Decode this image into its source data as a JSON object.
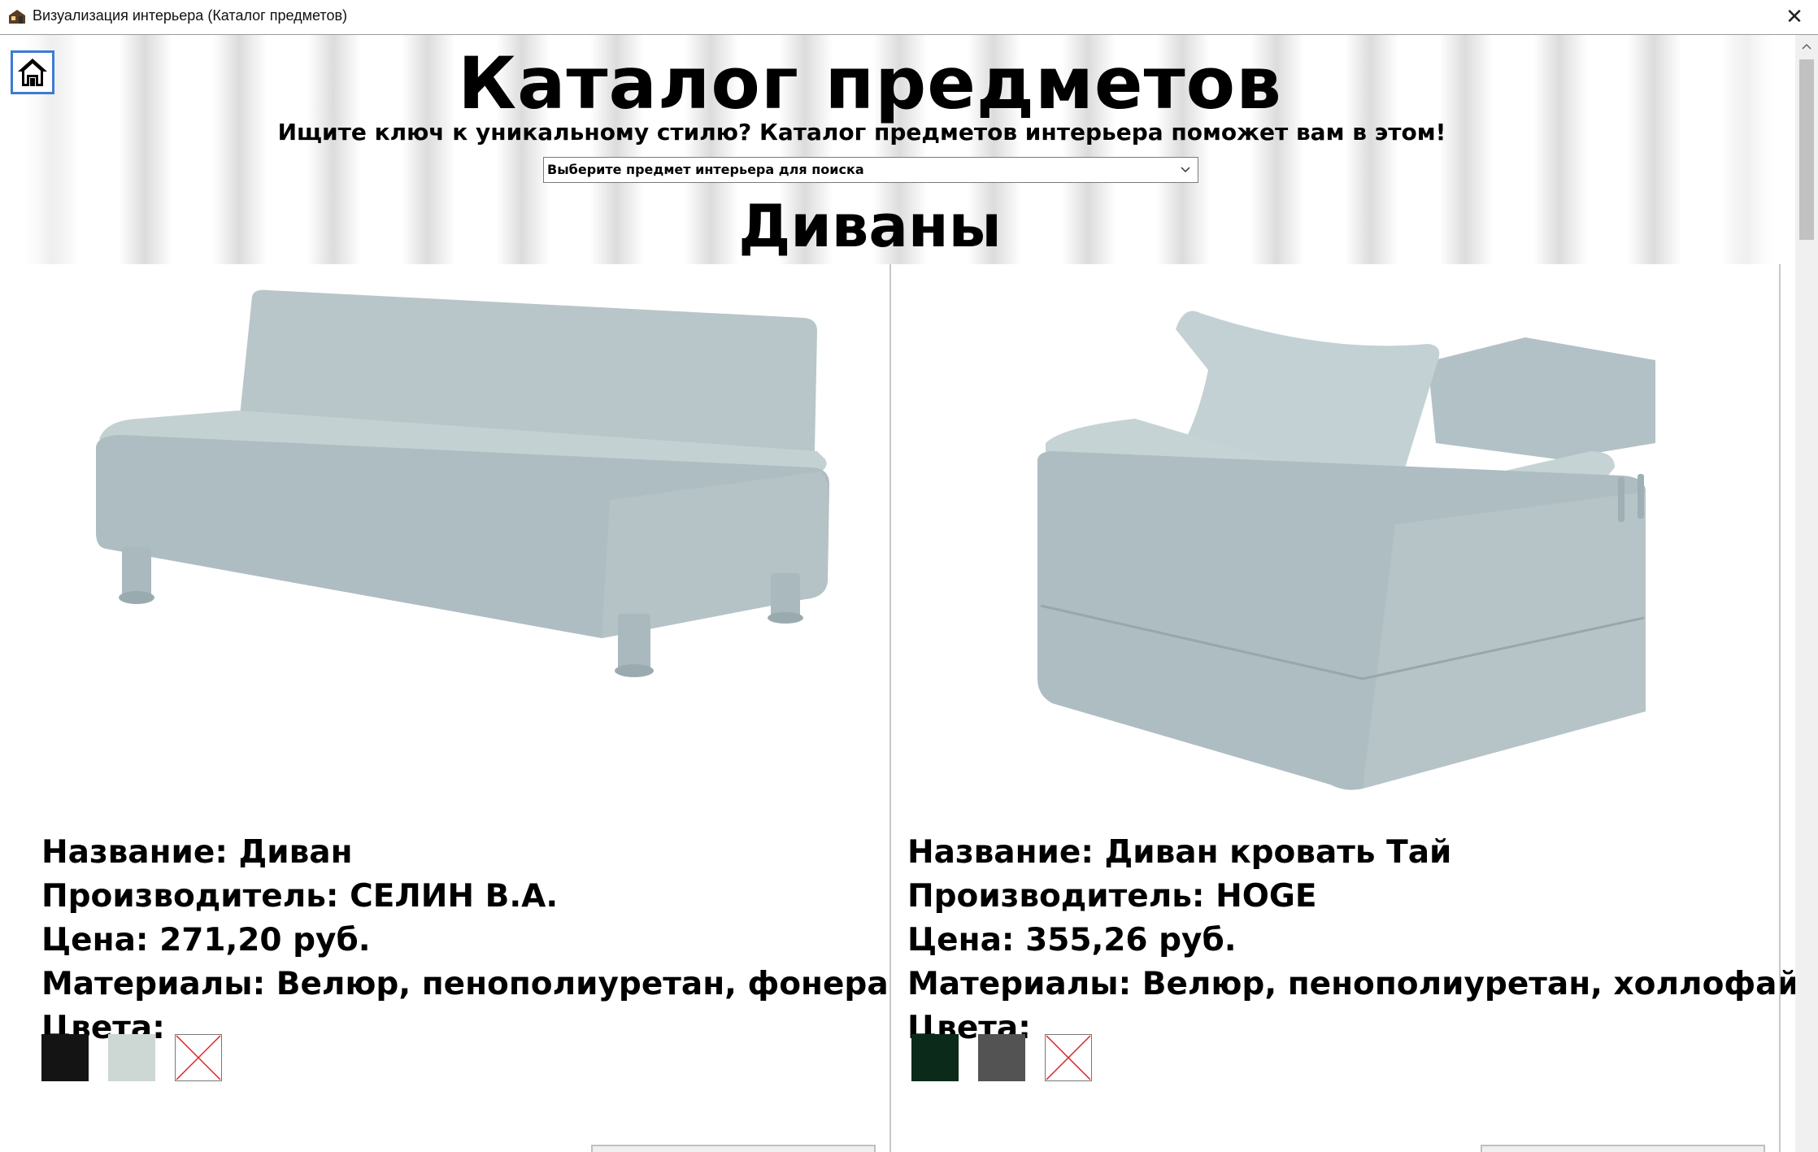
{
  "window": {
    "title": "Визуализация интерьера (Каталог предметов)",
    "close_label": "✕"
  },
  "header": {
    "title": "Каталог предметов",
    "subtitle": "Ищите ключ к уникальному стилю? Каталог предметов интерьера поможет вам в этом!",
    "search_select_value": "Выберите предмет интерьера для поиска",
    "section_title": "Диваны"
  },
  "icons": {
    "home": "home-icon",
    "app": "house-app-icon",
    "dropdown": "chevron-down-icon"
  },
  "products": [
    {
      "name_line": "Название: Диван",
      "maker_line": "Производитель: СЕЛИН В.А.",
      "price_line": "Цена: 271,20  руб.",
      "materials_line": "Материалы:  Велюр,  пенополиуретан,  фонера",
      "colors_label": "Цвета:",
      "colors": [
        "#141414",
        "#cdd8d5",
        "none"
      ]
    },
    {
      "name_line": "Название: Диван кровать Тай",
      "maker_line": "Производитель: HOGE",
      "price_line": "Цена: 355,26 руб.",
      "materials_line": "Материалы: Велюр, пенополиуретан, холлофайбер",
      "colors_label": "Цвета:",
      "colors": [
        "#0b2a19",
        "#535353",
        "none"
      ]
    }
  ],
  "colors": {
    "home_border": "#3b7bd6",
    "product_fabric": "#aebdc2",
    "button_fill": "#b9defc"
  }
}
